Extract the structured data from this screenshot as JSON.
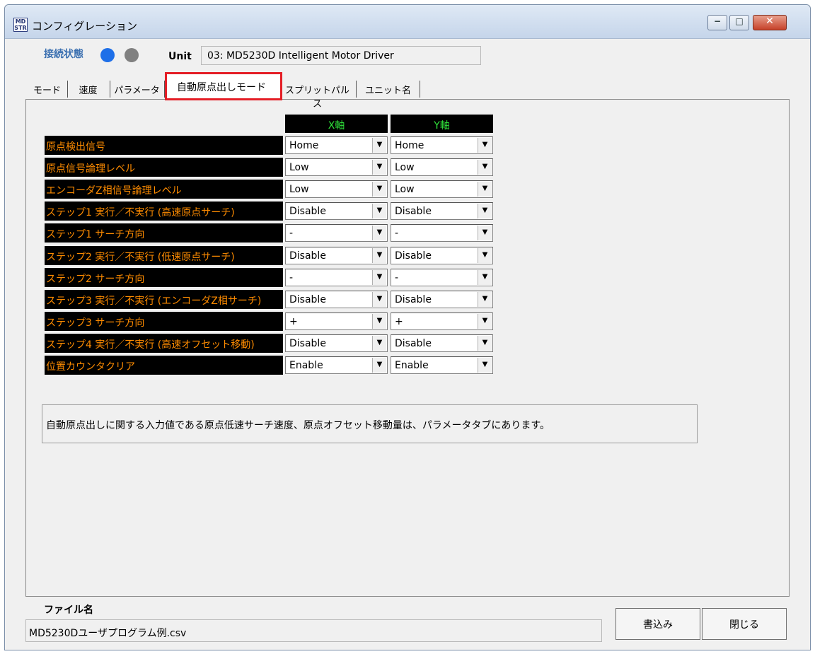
{
  "window": {
    "title": "コンフィグレーション",
    "icon_text": "MD\nSTR",
    "buttons": {
      "min": "−",
      "max": "□",
      "close": "✕"
    }
  },
  "status": {
    "label": "接続状態",
    "indicators": [
      {
        "name": "connected-indicator",
        "color": "#1e6fe8"
      },
      {
        "name": "disconnected-indicator",
        "color": "#808080"
      }
    ]
  },
  "unit": {
    "label": "Unit",
    "value": "03: MD5230D Intelligent Motor Driver"
  },
  "tabs": [
    {
      "label": "モード",
      "active": false
    },
    {
      "label": "速度",
      "active": false
    },
    {
      "label": "パラメータ",
      "active": false
    },
    {
      "label": "自動原点出しモード",
      "active": true
    },
    {
      "label": "スプリットパルス",
      "active": false
    },
    {
      "label": "ユニット名",
      "active": false
    }
  ],
  "table": {
    "headers": {
      "x": "X軸",
      "y": "Y軸"
    },
    "rows": [
      {
        "label": "原点検出信号",
        "x": "Home",
        "y": "Home"
      },
      {
        "label": "原点信号論理レベル",
        "x": "Low",
        "y": "Low"
      },
      {
        "label": "エンコーダZ相信号論理レベル",
        "x": "Low",
        "y": "Low"
      },
      {
        "label": "ステップ1 実行／不実行 (高速原点サーチ)",
        "x": "Disable",
        "y": "Disable"
      },
      {
        "label": "ステップ1 サーチ方向",
        "x": "-",
        "y": "-"
      },
      {
        "label": "ステップ2 実行／不実行 (低速原点サーチ)",
        "x": "Disable",
        "y": "Disable"
      },
      {
        "label": "ステップ2 サーチ方向",
        "x": "-",
        "y": "-"
      },
      {
        "label": "ステップ3 実行／不実行 (エンコーダZ相サーチ)",
        "x": "Disable",
        "y": "Disable"
      },
      {
        "label": "ステップ3 サーチ方向",
        "x": "+",
        "y": "+"
      },
      {
        "label": "ステップ4 実行／不実行 (高速オフセット移動)",
        "x": "Disable",
        "y": "Disable"
      },
      {
        "label": "位置カウンタクリア",
        "x": "Enable",
        "y": "Enable"
      }
    ]
  },
  "note": "自動原点出しに関する入力値である原点低速サーチ速度、原点オフセット移動量は、パラメータタブにあります。",
  "file": {
    "label": "ファイル名",
    "value": "MD5230Dユーザプログラム例.csv"
  },
  "buttons": {
    "write": "書込み",
    "close": "閉じる"
  },
  "colors": {
    "row_label_text": "#ff8c00",
    "axis_header_text": "#2fe03a",
    "active_tab_border": "#e41e26"
  }
}
